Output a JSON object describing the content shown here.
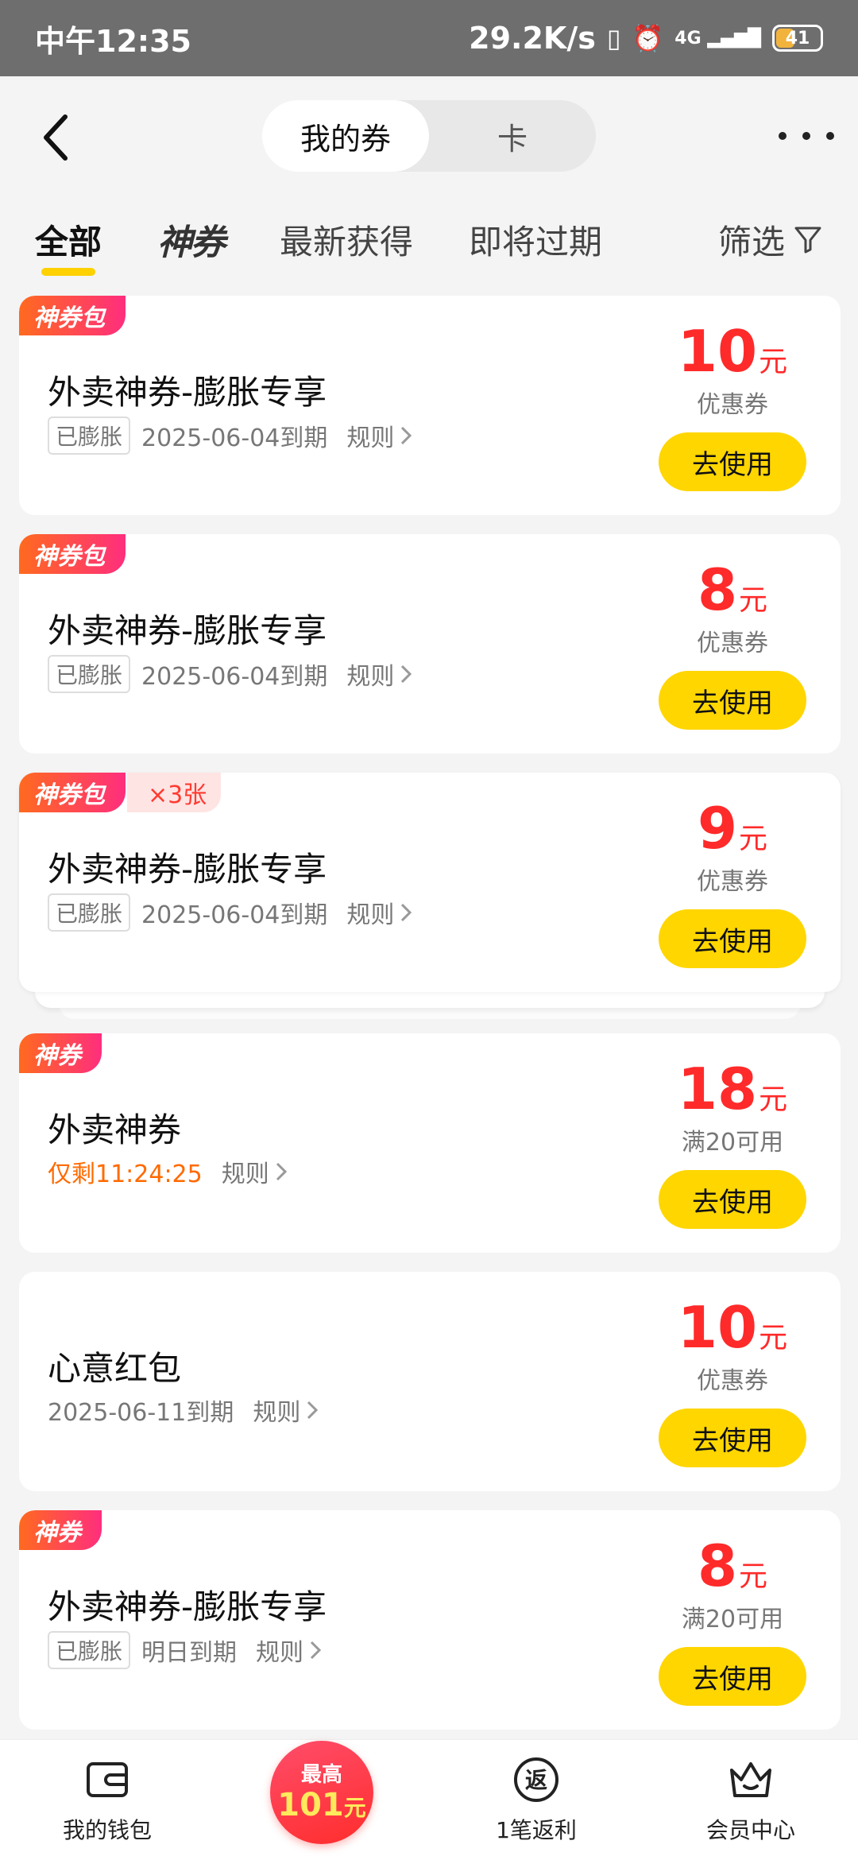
{
  "status_bar": {
    "time": "中午12:35",
    "speed": "29.2K/s",
    "network": "4G",
    "battery": "41",
    "battery_level": 0.41
  },
  "header": {
    "segments": [
      "我的券",
      "卡"
    ],
    "active_segment": 0
  },
  "tabs": [
    {
      "label": "全部"
    },
    {
      "label": "神券"
    },
    {
      "label": "最新获得"
    },
    {
      "label": "即将过期"
    },
    {
      "label": "筛选"
    }
  ],
  "coupons": [
    {
      "badge": "神券包",
      "title": "外卖神券-膨胀专享",
      "tag": "已膨胀",
      "expire": "2025-06-04到期",
      "rule": "规则",
      "amount": "10",
      "unit": "元",
      "subtype": "优惠券",
      "button": "去使用"
    },
    {
      "badge": "神券包",
      "title": "外卖神券-膨胀专享",
      "tag": "已膨胀",
      "expire": "2025-06-04到期",
      "rule": "规则",
      "amount": "8",
      "unit": "元",
      "subtype": "优惠券",
      "button": "去使用"
    },
    {
      "badge": "神券包",
      "badge_extra": "×3张",
      "title": "外卖神券-膨胀专享",
      "tag": "已膨胀",
      "expire": "2025-06-04到期",
      "rule": "规则",
      "amount": "9",
      "unit": "元",
      "subtype": "优惠券",
      "button": "去使用"
    },
    {
      "badge": "神券",
      "title": "外卖神券",
      "expire": "仅剩11:24:25",
      "rule": "规则",
      "amount": "18",
      "unit": "元",
      "subtype": "满20可用",
      "button": "去使用"
    },
    {
      "title": "心意红包",
      "expire": "2025-06-11到期",
      "rule": "规则",
      "amount": "10",
      "unit": "元",
      "subtype": "优惠券",
      "button": "去使用"
    },
    {
      "badge": "神券",
      "title": "外卖神券-膨胀专享",
      "tag": "已膨胀",
      "expire": "明日到期",
      "rule": "规则",
      "amount": "8",
      "unit": "元",
      "subtype": "满20可用",
      "button": "去使用"
    }
  ],
  "bottom_bar": {
    "wallet": "我的钱包",
    "promo_top": "最高",
    "promo_amount": "101",
    "promo_unit": "元",
    "rebate_icon": "返",
    "rebate": "1笔返利",
    "member": "会员中心"
  },
  "colors": {
    "accent_yellow": "#ffd600",
    "price_red": "#ff2a2a",
    "badge_gradient_start": "#ff6a1f",
    "badge_gradient_end": "#ff2e7d"
  }
}
